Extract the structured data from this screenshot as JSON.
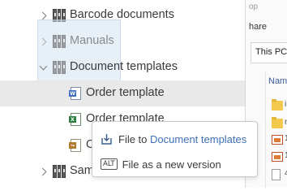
{
  "tree": {
    "items": [
      {
        "label": "Barcode documents",
        "icon": "binder-icon"
      },
      {
        "label": "Manuals",
        "icon": "binder-icon"
      },
      {
        "label": "Document templates",
        "icon": "binder-icon"
      },
      {
        "label": "Order template",
        "icon": "word-document-icon"
      },
      {
        "label": "Order template",
        "icon": "excel-document-icon"
      },
      {
        "label": "O",
        "icon": "linked-document-icon"
      },
      {
        "label": "Sam",
        "icon": "binder-icon"
      }
    ]
  },
  "explorer": {
    "title_fragment": "op",
    "share_fragment": "hare",
    "address_fragment": "This PC",
    "column_header_fragment": "Nam",
    "rows": [
      {
        "icon": "folder-icon",
        "tail": "i"
      },
      {
        "icon": "folder-icon",
        "tail": "n"
      },
      {
        "icon": "image-file-icon",
        "tail": "1"
      },
      {
        "icon": "image-file-icon",
        "tail": "1"
      },
      {
        "icon": "page-file-icon",
        "tail": "4"
      }
    ]
  },
  "dropmenu": {
    "file_to_prefix": "File to",
    "file_to_target": "Document templates",
    "alt_key": "ALT",
    "new_version_label": "File as a new version"
  },
  "colors": {
    "accent_link": "#3d6fb5",
    "highlight_row": "#e9e9e9",
    "drag_ghost": "#d6e4f0"
  }
}
